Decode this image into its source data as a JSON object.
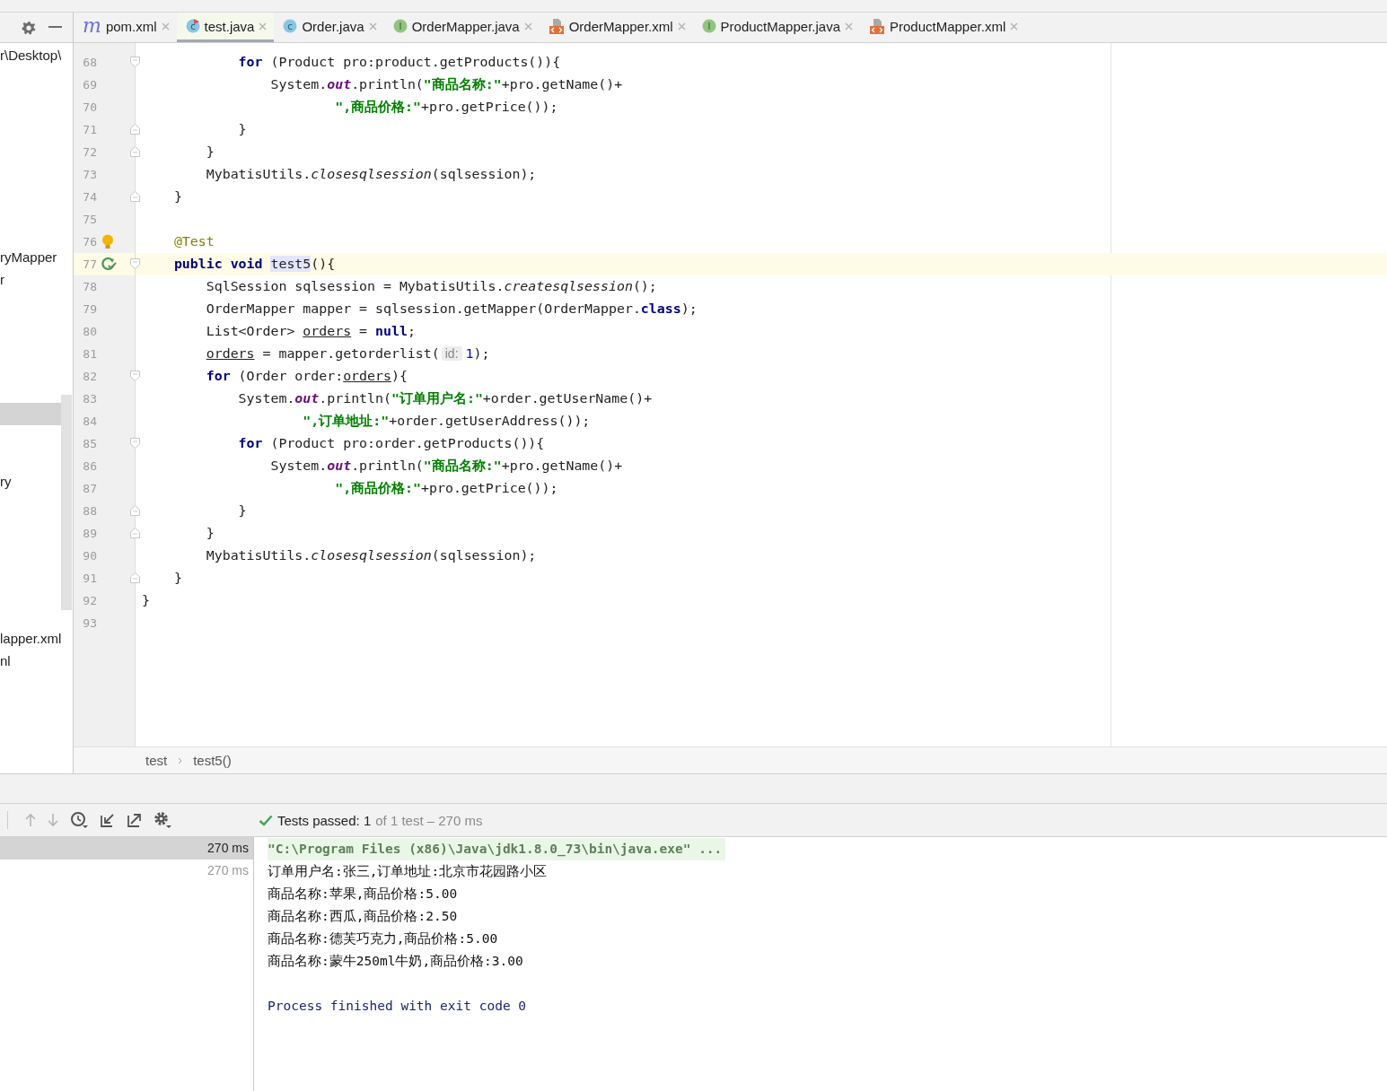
{
  "project_panel": {
    "items": [
      {
        "label": "r\\Desktop\\",
        "selected": false
      },
      {
        "label": "ryMapper",
        "selected": false
      },
      {
        "label": "r",
        "selected": false
      },
      {
        "selected": true
      },
      {
        "label": "ry",
        "selected": false
      },
      {
        "label": "lapper.xml",
        "selected": false
      },
      {
        "label": "nl",
        "selected": false
      }
    ]
  },
  "tabs": [
    {
      "label": "pom.xml",
      "kind": "maven",
      "icon_letter": "m",
      "selected": false
    },
    {
      "label": "test.java",
      "kind": "class",
      "icon_letter": "c",
      "runnable": true,
      "selected": true
    },
    {
      "label": "Order.java",
      "kind": "class",
      "icon_letter": "c",
      "runnable": false,
      "selected": false
    },
    {
      "label": "OrderMapper.java",
      "kind": "interface",
      "icon_letter": "I",
      "runnable": false,
      "selected": false
    },
    {
      "label": "OrderMapper.xml",
      "kind": "xml",
      "selected": false
    },
    {
      "label": "ProductMapper.java",
      "kind": "interface",
      "icon_letter": "I",
      "runnable": false,
      "selected": false
    },
    {
      "label": "ProductMapper.xml",
      "kind": "xml",
      "selected": false
    }
  ],
  "editor": {
    "lines": [
      {
        "number": "68",
        "fold": {
          "kind": "start"
        },
        "current": false,
        "tokens": [
          {
            "t": "            for",
            "kind": "kw"
          },
          {
            "t": " (Product pro:product.getProducts()){",
            "kind": "plain"
          }
        ]
      },
      {
        "number": "69",
        "current": false,
        "tokens": [
          {
            "t": "                System.",
            "kind": "plain"
          },
          {
            "t": "out",
            "kind": "field"
          },
          {
            "t": ".println(",
            "kind": "plain"
          },
          {
            "t": "\"商品名称:\"",
            "kind": "string"
          },
          {
            "t": "+pro.getName()+",
            "kind": "plain"
          }
        ]
      },
      {
        "number": "70",
        "current": false,
        "tokens": [
          {
            "t": "                        \",商品价格:\"",
            "kind": "string"
          },
          {
            "t": "+pro.getPrice());",
            "kind": "plain"
          }
        ]
      },
      {
        "number": "71",
        "fold": {
          "kind": "end"
        },
        "current": false,
        "tokens": [
          {
            "t": "            }",
            "kind": "plain"
          }
        ]
      },
      {
        "number": "72",
        "fold": {
          "kind": "end"
        },
        "current": false,
        "tokens": [
          {
            "t": "        }",
            "kind": "plain"
          }
        ]
      },
      {
        "number": "73",
        "current": false,
        "tokens": [
          {
            "t": "        MybatisUtils.",
            "kind": "plain"
          },
          {
            "t": "closesqlsession",
            "kind": "static"
          },
          {
            "t": "(sqlsession);",
            "kind": "plain"
          }
        ]
      },
      {
        "number": "74",
        "fold": {
          "kind": "end"
        },
        "current": false,
        "tokens": [
          {
            "t": "    }",
            "kind": "plain"
          }
        ]
      },
      {
        "number": "75",
        "current": false
      },
      {
        "number": "76",
        "gutter_icon": {
          "kind": "bulb"
        },
        "current": false,
        "tokens": [
          {
            "t": "    @Test",
            "kind": "annotation"
          }
        ]
      },
      {
        "number": "77",
        "gutter_icon": {
          "kind": "run"
        },
        "fold": {
          "kind": "start"
        },
        "current": true,
        "tokens": [
          {
            "t": "    public void",
            "kind": "kw"
          },
          {
            "t": " test5",
            "kind": "highlight"
          },
          {
            "t": "(){",
            "kind": "plain"
          }
        ]
      },
      {
        "number": "78",
        "current": false,
        "tokens": [
          {
            "t": "        SqlSession sqlsession = MybatisUtils.",
            "kind": "plain"
          },
          {
            "t": "createsqlsession",
            "kind": "static"
          },
          {
            "t": "();",
            "kind": "plain"
          }
        ]
      },
      {
        "number": "79",
        "current": false,
        "tokens": [
          {
            "t": "        OrderMapper mapper = sqlsession.getMapper(OrderMapper.",
            "kind": "plain"
          },
          {
            "t": "class",
            "kind": "kw"
          },
          {
            "t": ");",
            "kind": "plain"
          }
        ]
      },
      {
        "number": "80",
        "current": false,
        "tokens": [
          {
            "t": "        List<Order>",
            "kind": "plain"
          },
          {
            "t": " orders",
            "kind": "reassigned"
          },
          {
            "t": " =",
            "kind": "plain"
          },
          {
            "t": " null",
            "kind": "kw"
          },
          {
            "t": ";",
            "kind": "plain"
          }
        ]
      },
      {
        "number": "81",
        "current": false,
        "tokens": [
          {
            "t": "        orders",
            "kind": "reassigned"
          },
          {
            "t": " = mapper.getorderlist(",
            "kind": "plain"
          },
          {
            "t": "id:",
            "kind": "hint"
          },
          {
            "t": "1",
            "kind": "number"
          },
          {
            "t": ");",
            "kind": "plain"
          }
        ]
      },
      {
        "number": "82",
        "fold": {
          "kind": "start"
        },
        "current": false,
        "tokens": [
          {
            "t": "        for",
            "kind": "kw"
          },
          {
            "t": " (Order order:",
            "kind": "plain"
          },
          {
            "t": "orders",
            "kind": "reassigned"
          },
          {
            "t": "){",
            "kind": "plain"
          }
        ]
      },
      {
        "number": "83",
        "current": false,
        "tokens": [
          {
            "t": "            System.",
            "kind": "plain"
          },
          {
            "t": "out",
            "kind": "field"
          },
          {
            "t": ".println(",
            "kind": "plain"
          },
          {
            "t": "\"订单用户名:\"",
            "kind": "string"
          },
          {
            "t": "+order.getUserName()+",
            "kind": "plain"
          }
        ]
      },
      {
        "number": "84",
        "current": false,
        "tokens": [
          {
            "t": "                    \",订单地址:\"",
            "kind": "string"
          },
          {
            "t": "+order.getUserAddress());",
            "kind": "plain"
          }
        ]
      },
      {
        "number": "85",
        "fold": {
          "kind": "start"
        },
        "current": false,
        "tokens": [
          {
            "t": "            for",
            "kind": "kw"
          },
          {
            "t": " (Product pro:order.getProducts()){",
            "kind": "plain"
          }
        ]
      },
      {
        "number": "86",
        "current": false,
        "tokens": [
          {
            "t": "                System.",
            "kind": "plain"
          },
          {
            "t": "out",
            "kind": "field"
          },
          {
            "t": ".println(",
            "kind": "plain"
          },
          {
            "t": "\"商品名称:\"",
            "kind": "string"
          },
          {
            "t": "+pro.getName()+",
            "kind": "plain"
          }
        ]
      },
      {
        "number": "87",
        "current": false,
        "tokens": [
          {
            "t": "                        \",商品价格:\"",
            "kind": "string"
          },
          {
            "t": "+pro.getPrice());",
            "kind": "plain"
          }
        ]
      },
      {
        "number": "88",
        "fold": {
          "kind": "end"
        },
        "current": false,
        "tokens": [
          {
            "t": "            }",
            "kind": "plain"
          }
        ]
      },
      {
        "number": "89",
        "fold": {
          "kind": "end"
        },
        "current": false,
        "tokens": [
          {
            "t": "        }",
            "kind": "plain"
          }
        ]
      },
      {
        "number": "90",
        "current": false,
        "tokens": [
          {
            "t": "        MybatisUtils.",
            "kind": "plain"
          },
          {
            "t": "closesqlsession",
            "kind": "static"
          },
          {
            "t": "(sqlsession);",
            "kind": "plain"
          }
        ]
      },
      {
        "number": "91",
        "fold": {
          "kind": "end"
        },
        "current": false,
        "tokens": [
          {
            "t": "    }",
            "kind": "plain"
          }
        ]
      },
      {
        "number": "92",
        "current": false,
        "tokens": [
          {
            "t": "}",
            "kind": "plain"
          }
        ]
      },
      {
        "number": "93",
        "current": false
      }
    ]
  },
  "breadcrumb": [
    "test",
    "test5()"
  ],
  "run_panel": {
    "status_main": "Tests passed: 1",
    "status_detail": "of 1 test – 270 ms",
    "tests": [
      {
        "time": "270 ms",
        "selected": true
      },
      {
        "time": "270 ms",
        "selected": false
      }
    ],
    "console": [
      {
        "kind": "cmd",
        "text": "\"C:\\Program Files (x86)\\Java\\jdk1.8.0_73\\bin\\java.exe\" ..."
      },
      {
        "kind": "out",
        "text": "订单用户名:张三,订单地址:北京市花园路小区"
      },
      {
        "kind": "out",
        "text": "商品名称:苹果,商品价格:5.00"
      },
      {
        "kind": "out",
        "text": "商品名称:西瓜,商品价格:2.50"
      },
      {
        "kind": "out",
        "text": "商品名称:德芙巧克力,商品价格:5.00"
      },
      {
        "kind": "out",
        "text": "商品名称:蒙牛250ml牛奶,商品价格:3.00"
      },
      {
        "kind": "blank"
      },
      {
        "kind": "exit",
        "text": "Process finished with exit code 0"
      }
    ]
  }
}
